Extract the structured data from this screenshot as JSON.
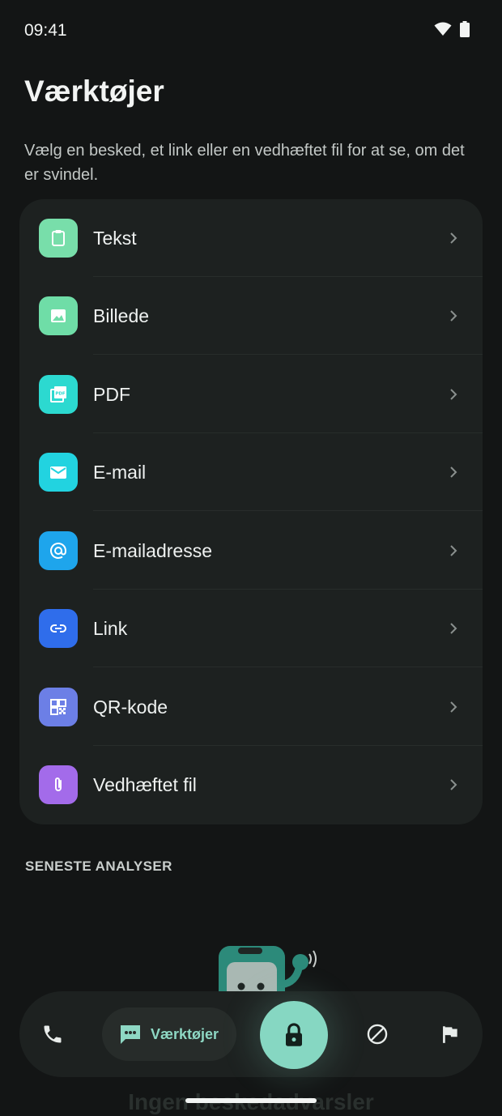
{
  "status": {
    "time": "09:41"
  },
  "header": {
    "title": "Værktøjer",
    "description": "Vælg en besked, et link eller en vedhæftet fil for at se, om det er svindel."
  },
  "tools": [
    {
      "label": "Tekst",
      "icon": "clipboard-icon",
      "color": "#78DEAA"
    },
    {
      "label": "Billede",
      "icon": "image-icon",
      "color": "#6FDDA7"
    },
    {
      "label": "PDF",
      "icon": "pdf-icon",
      "color": "#2CD9D0"
    },
    {
      "label": "E-mail",
      "icon": "mail-icon",
      "color": "#22D3E0"
    },
    {
      "label": "E-mailadresse",
      "icon": "at-icon",
      "color": "#1EA5EC"
    },
    {
      "label": "Link",
      "icon": "link-icon",
      "color": "#2F6DEB"
    },
    {
      "label": "QR-kode",
      "icon": "qr-code-icon",
      "color": "#6C7FE6"
    },
    {
      "label": "Vedhæftet fil",
      "icon": "paperclip-icon",
      "color": "#A36BEA"
    }
  ],
  "recent": {
    "header": "SENESTE ANALYSER",
    "empty_text": "Ingen beskedadvarsler"
  },
  "nav": {
    "tools_label": "Værktøjer",
    "accent": "#86D7C2"
  }
}
